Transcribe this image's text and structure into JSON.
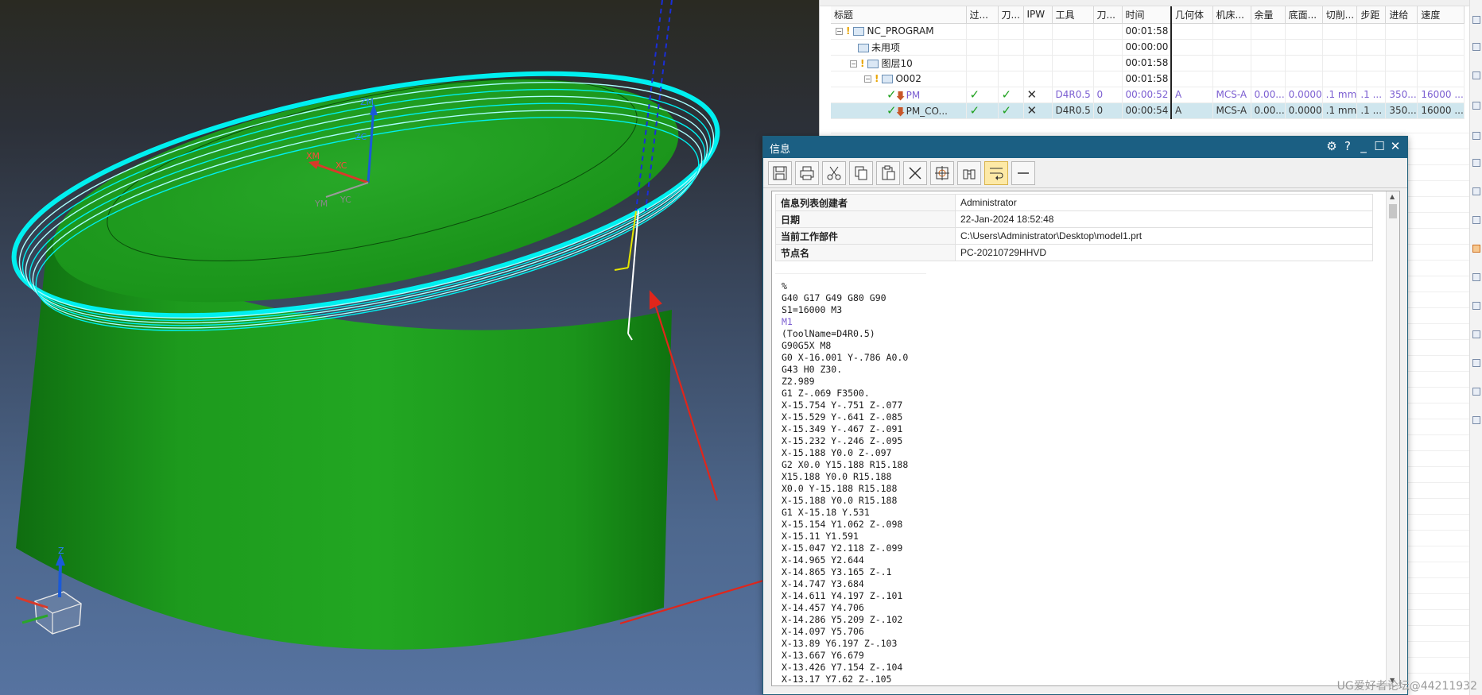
{
  "navigator": {
    "columns": [
      "标题",
      "过...",
      "刀...",
      "IPW",
      "工具",
      "刀...",
      "时间",
      "几何体",
      "机床...",
      "余量",
      "底面...",
      "切削...",
      "步距",
      "进给",
      "速度"
    ],
    "rows": [
      {
        "name": "NC_PROGRAM",
        "time": "00:01:58",
        "kind": "root"
      },
      {
        "name": "未用项",
        "time": "00:00:00",
        "kind": "folder"
      },
      {
        "name": "图层10",
        "time": "00:01:58",
        "kind": "group"
      },
      {
        "name": "O002",
        "time": "00:01:58",
        "kind": "subgroup"
      },
      {
        "name": "PM",
        "tool": "D4R0.5",
        "tool_no": "0",
        "time": "00:00:52",
        "geometry": "A",
        "machine": "MCS-A",
        "stock": "0.00...",
        "floor": "0.0000",
        "cut": ".1 mm",
        "step": ".1 ...",
        "feed": "350...",
        "speed": "16000 ...",
        "kind": "op"
      },
      {
        "name": "PM_CO...",
        "tool": "D4R0.5",
        "tool_no": "0",
        "time": "00:00:54",
        "geometry": "A",
        "machine": "MCS-A",
        "stock": "0.00...",
        "floor": "0.0000",
        "cut": ".1 mm",
        "step": ".1 ...",
        "feed": "350...",
        "speed": "16000 ...",
        "kind": "op-selected"
      }
    ]
  },
  "info_window": {
    "title": "信息",
    "props": [
      {
        "key": "信息列表创建者",
        "value": "Administrator"
      },
      {
        "key": "日期",
        "value": "22-Jan-2024 18:52:48"
      },
      {
        "key": "当前工作部件",
        "value": "C:\\Users\\Administrator\\Desktop\\model1.prt"
      },
      {
        "key": "节点名",
        "value": "PC-20210729HHVD"
      }
    ],
    "gcode": [
      "%",
      "G40 G17 G49 G80 G90",
      "S1=16000 M3",
      "M1",
      "(ToolName=D4R0.5)",
      "G90G5X M8",
      "G0 X-16.001 Y-.786 A0.0",
      "G43 H0 Z30.",
      "Z2.989",
      "G1 Z-.069 F3500.",
      "X-15.754 Y-.751 Z-.077",
      "X-15.529 Y-.641 Z-.085",
      "X-15.349 Y-.467 Z-.091",
      "X-15.232 Y-.246 Z-.095",
      "X-15.188 Y0.0 Z-.097",
      "G2 X0.0 Y15.188 R15.188",
      "X15.188 Y0.0 R15.188",
      "X0.0 Y-15.188 R15.188",
      "X-15.188 Y0.0 R15.188",
      "G1 X-15.18 Y.531",
      "X-15.154 Y1.062 Z-.098",
      "X-15.11 Y1.591",
      "X-15.047 Y2.118 Z-.099",
      "X-14.965 Y2.644",
      "X-14.865 Y3.165 Z-.1",
      "X-14.747 Y3.684",
      "X-14.611 Y4.197 Z-.101",
      "X-14.457 Y4.706",
      "X-14.286 Y5.209 Z-.102",
      "X-14.097 Y5.706",
      "X-13.89 Y6.197 Z-.103",
      "X-13.667 Y6.679",
      "X-13.426 Y7.154 Z-.104",
      "X-13.17 Y7.62 Z-.105"
    ]
  },
  "viewport": {
    "axis_labels": {
      "zm": "ZM",
      "zc": "ZC",
      "xm": "XM",
      "xc": "XC",
      "ym": "YM",
      "yc": "YC",
      "z": "Z"
    }
  },
  "watermark": "UG爱好者论坛@44211932",
  "colors": {
    "part": "#1e9a1e",
    "toolpath": "#00f0f0",
    "titlebar": "#1b5f83",
    "arrow": "#e0261b"
  }
}
